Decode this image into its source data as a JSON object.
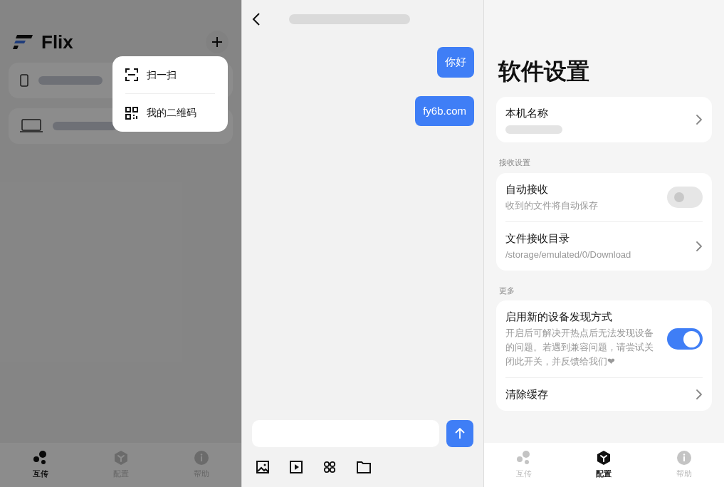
{
  "home": {
    "app_name": "Flix",
    "menu": [
      {
        "label": "扫一扫",
        "kind": "scan"
      },
      {
        "label": "我的二维码",
        "kind": "qr"
      }
    ],
    "devices": [
      {
        "kind": "phone"
      },
      {
        "kind": "laptop"
      }
    ],
    "tabs": [
      {
        "label": "互传",
        "kind": "transfer",
        "selected": true
      },
      {
        "label": "配置",
        "kind": "config",
        "selected": false
      },
      {
        "label": "帮助",
        "kind": "help",
        "selected": false
      }
    ]
  },
  "chat": {
    "messages": [
      {
        "text": "你好"
      },
      {
        "text": "fy6b.com"
      }
    ],
    "attachments": [
      {
        "kind": "image"
      },
      {
        "kind": "video"
      },
      {
        "kind": "apps"
      },
      {
        "kind": "folder"
      }
    ]
  },
  "settings": {
    "title": "软件设置",
    "groups": [
      {
        "items": [
          {
            "kind": "link",
            "title": "本机名称"
          }
        ]
      },
      {
        "header": "接收设置",
        "items": [
          {
            "kind": "switch",
            "title": "自动接收",
            "subtitle": "收到的文件将自动保存",
            "on": false
          },
          {
            "kind": "link",
            "title": "文件接收目录",
            "subtitle": "/storage/emulated/0/Download"
          }
        ]
      },
      {
        "header": "更多",
        "items": [
          {
            "kind": "switch",
            "title": "启用新的设备发现方式",
            "subtitle": "开启后可解决开热点后无法发现设备的问题。若遇到兼容问题，请尝试关闭此开关，并反馈给我们❤",
            "on": true
          },
          {
            "kind": "link",
            "title": "清除缓存"
          }
        ]
      }
    ],
    "tabs": [
      {
        "label": "互传",
        "kind": "transfer",
        "selected": false
      },
      {
        "label": "配置",
        "kind": "config",
        "selected": true
      },
      {
        "label": "帮助",
        "kind": "help",
        "selected": false
      }
    ]
  }
}
